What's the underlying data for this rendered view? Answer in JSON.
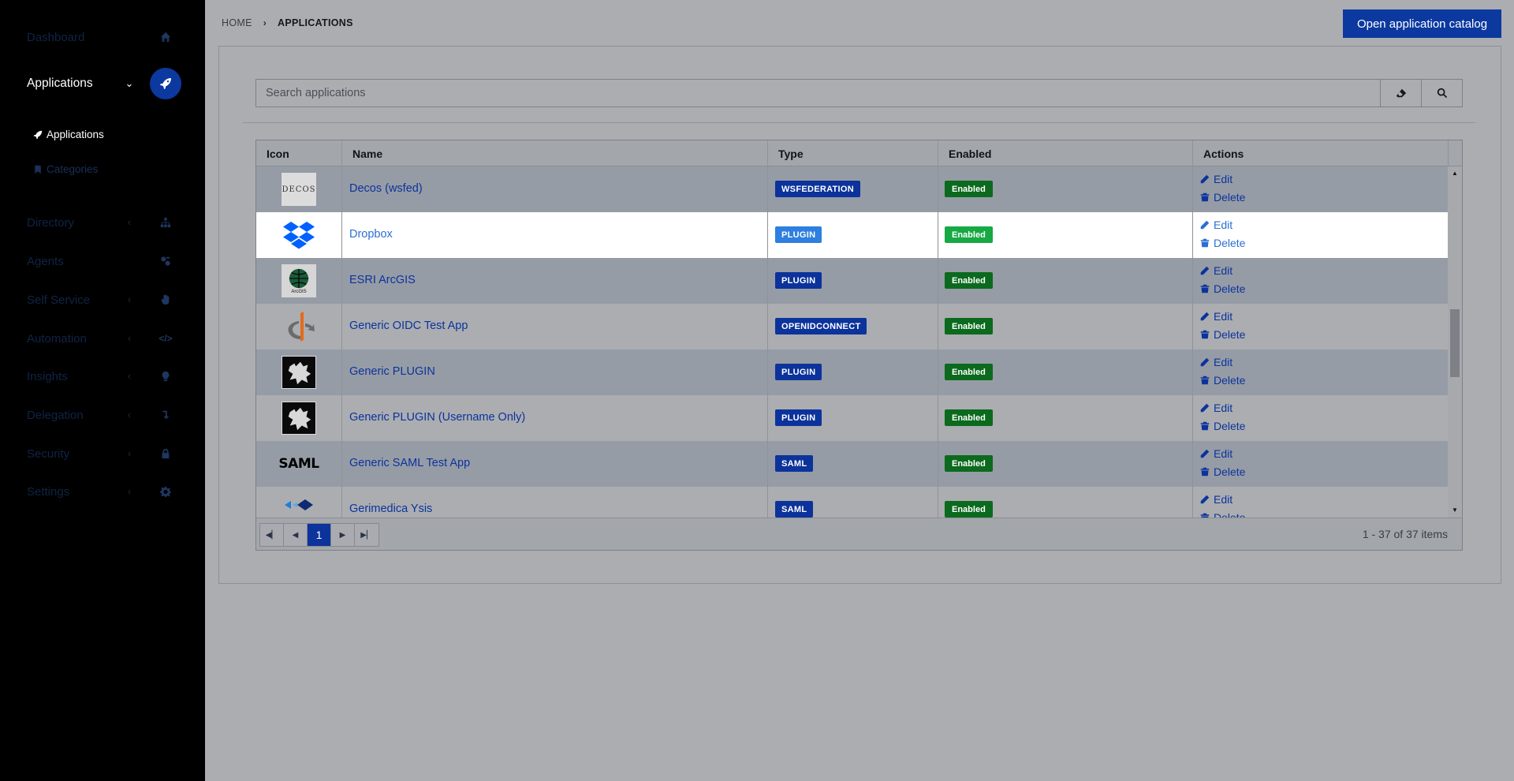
{
  "sidebar": {
    "items": [
      {
        "label": "Dashboard",
        "icon": "home-icon"
      },
      {
        "label": "Applications",
        "icon": "rocket-icon",
        "active": true
      },
      {
        "label": "Directory",
        "icon": "sitemap-icon"
      },
      {
        "label": "Agents",
        "icon": "agents-icon"
      },
      {
        "label": "Self Service",
        "icon": "hand-icon"
      },
      {
        "label": "Automation",
        "icon": "code-icon"
      },
      {
        "label": "Insights",
        "icon": "lightbulb-icon"
      },
      {
        "label": "Delegation",
        "icon": "delegation-icon"
      },
      {
        "label": "Security",
        "icon": "lock-icon"
      },
      {
        "label": "Settings",
        "icon": "gear-icon"
      }
    ],
    "sub_items": [
      {
        "label": "Applications",
        "icon": "rocket-icon"
      },
      {
        "label": "Categories",
        "icon": "bookmark-icon"
      }
    ]
  },
  "breadcrumb": {
    "home": "HOME",
    "current": "APPLICATIONS"
  },
  "header": {
    "catalog_button": "Open application catalog"
  },
  "search": {
    "placeholder": "Search applications"
  },
  "table": {
    "columns": [
      "Icon",
      "Name",
      "Type",
      "Enabled",
      "Actions"
    ],
    "rows": [
      {
        "name": "Decos (wsfed)",
        "type": "WSFEDERATION",
        "enabled": "Enabled",
        "icon_text": "DECOS"
      },
      {
        "name": "Dropbox",
        "type": "PLUGIN",
        "enabled": "Enabled",
        "highlight": true
      },
      {
        "name": "ESRI ArcGIS",
        "type": "PLUGIN",
        "enabled": "Enabled",
        "icon_text": "ArcGIS"
      },
      {
        "name": "Generic OIDC Test App",
        "type": "OPENIDCONNECT",
        "enabled": "Enabled"
      },
      {
        "name": "Generic PLUGIN",
        "type": "PLUGIN",
        "enabled": "Enabled"
      },
      {
        "name": "Generic PLUGIN (Username Only)",
        "type": "PLUGIN",
        "enabled": "Enabled"
      },
      {
        "name": "Generic SAML Test App",
        "type": "SAML",
        "enabled": "Enabled",
        "icon_text": "SAML"
      },
      {
        "name": "Gerimedica Ysis",
        "type": "SAML",
        "enabled": "Enabled"
      }
    ],
    "edit_label": "Edit",
    "delete_label": "Delete"
  },
  "pager": {
    "current_page": "1",
    "info": "1 - 37 of 37 items"
  },
  "colors": {
    "accent": "#0c39a0",
    "enabled_green": "#0b6a1d",
    "highlight_blue": "#2e7fe0"
  }
}
